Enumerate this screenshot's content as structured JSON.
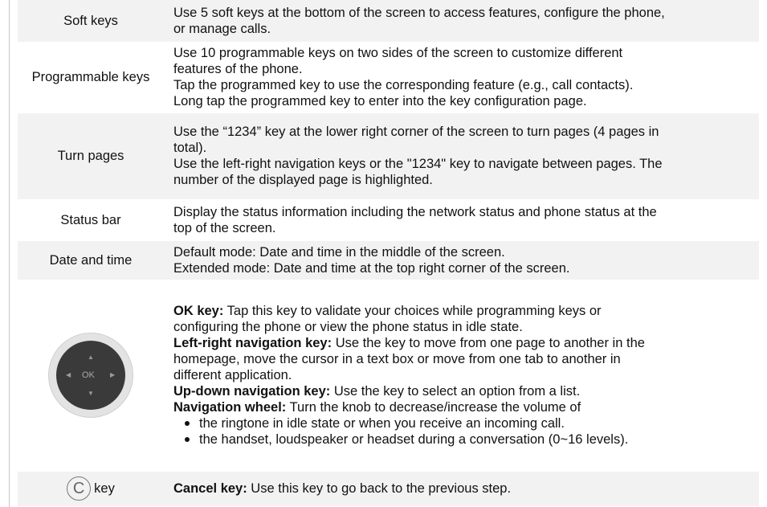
{
  "rows": [
    {
      "label": "Soft keys",
      "lines": [
        "Use 5 soft keys at the bottom of the screen to access features, configure the phone,",
        "or manage calls."
      ]
    },
    {
      "label": "Programmable keys",
      "lines": [
        "Use 10 programmable keys on two sides of the screen to customize different",
        "features of the phone.",
        "Tap the programmed key to use the corresponding feature (e.g., call contacts).",
        "Long tap the programmed key to enter into the key configuration page."
      ]
    },
    {
      "label": "Turn pages",
      "lines": [
        "Use the “1234” key at the lower right corner of the screen to turn pages (4 pages in",
        "total).",
        "Use the left-right navigation keys or the \"1234\" key to navigate between pages. The",
        "number of the displayed page is highlighted."
      ]
    },
    {
      "label": "Status bar",
      "lines": [
        "Display the status information including the network status and phone status at the",
        "top of the screen."
      ]
    },
    {
      "label": "Date and time",
      "lines": [
        "Default mode: Date and time in the middle of the screen.",
        "Extended mode: Date and time at the top right corner of the screen."
      ]
    }
  ],
  "navigation": {
    "wheel": {
      "ok": "OK",
      "up": "▲",
      "down": "▼",
      "left": "◀",
      "right": "▶"
    },
    "ok_title": "OK key:",
    "ok_text1": " Tap this key to validate your choices while programming keys or",
    "ok_text2": "configuring the phone or view the phone status in idle state.",
    "lr_title": "Left-right navigation key:",
    "lr_text1": " Use the key to move from one page to another in the",
    "lr_text2": "homepage, move the cursor in a text box or move from one tab to another in",
    "lr_text3": "different application.",
    "ud_title": "Up-down navigation key:",
    "ud_text": " Use the key to select an option from a list.",
    "wheel_title": "Navigation wheel:",
    "wheel_text": " Turn the knob to decrease/increase the volume of",
    "bullets": [
      "the ringtone in idle state or when you receive an incoming call.",
      "the handset, loudspeaker or headset during a conversation (0~16 levels)."
    ]
  },
  "cancel": {
    "icon_glyph": "C",
    "label": "key",
    "title": "Cancel key:",
    "text": " Use this key to go back to the previous step."
  }
}
